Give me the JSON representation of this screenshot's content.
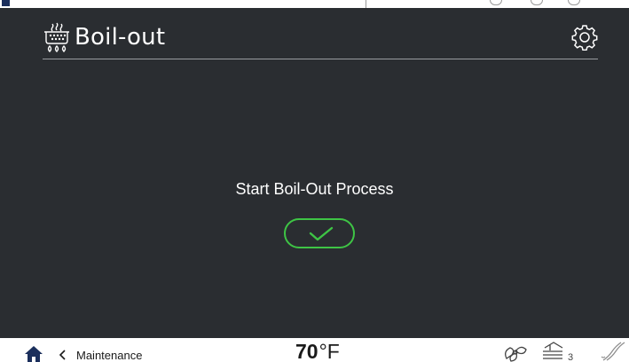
{
  "header": {
    "title": "Boil-out",
    "title_icon": "boil-out-icon",
    "settings_icon": "gear-icon"
  },
  "main": {
    "prompt": "Start Boil-Out Process",
    "confirm_icon": "checkmark-icon",
    "confirm_color": "#3ec445"
  },
  "footer": {
    "home_icon": "home-icon",
    "back_label": "Maintenance",
    "temperature": "70",
    "temperature_unit": "°F",
    "status_icons": [
      "fan-icon",
      "filter-level-icon",
      "oil-icon"
    ],
    "filter_level_badge": "3"
  },
  "colors": {
    "screen_background": "#2a2d31",
    "text": "#ffffff",
    "accent_green": "#3ec445"
  }
}
